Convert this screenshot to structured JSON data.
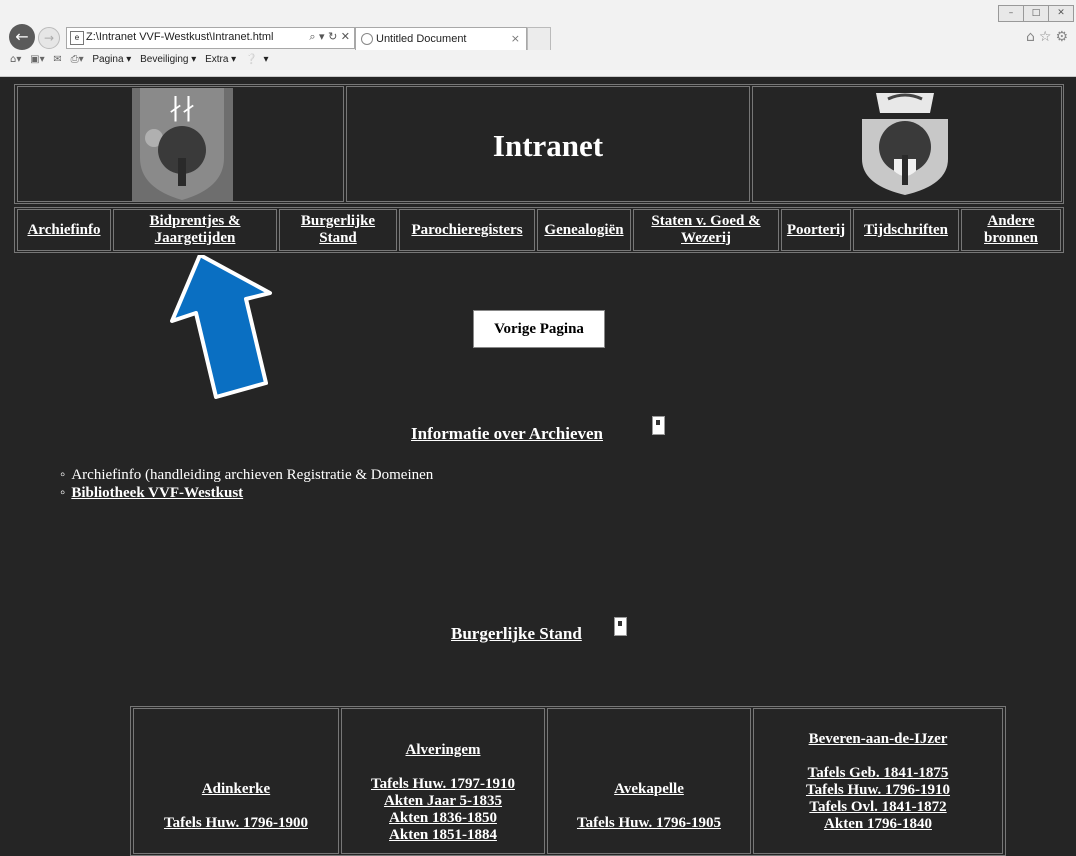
{
  "browser": {
    "address": "Z:\\Intranet VVF-Westkust\\Intranet.html",
    "address_controls": "⌕ ▾ ↻ ✕",
    "tab_title": "Untitled Document",
    "commandbar": {
      "page": "Pagina ▾",
      "security": "Beveiliging ▾",
      "extra": "Extra ▾",
      "help": "▾"
    }
  },
  "header": {
    "title": "Intranet"
  },
  "nav": [
    "Archiefinfo",
    "Bidprentjes & Jaargetijden",
    "Burgerlijke Stand",
    "Parochieregisters",
    "Genealogiën",
    "Staten v. Goed & Wezerij",
    "Poorterij",
    "Tijdschriften",
    "Andere bronnen"
  ],
  "prev_button": "Vorige Pagina",
  "section_archives": {
    "title": "Informatie over Archieven",
    "items": [
      "Archiefinfo (handleiding archieven Registratie & Domeinen",
      "Bibliotheek VVF-Westkust"
    ]
  },
  "section_stand": {
    "title": "Burgerlijke Stand"
  },
  "stand_table": [
    {
      "place": "Adinkerke",
      "links": [
        "Tafels Huw. 1796-1900"
      ]
    },
    {
      "place": "Alveringem",
      "links": [
        "Tafels Huw. 1797-1910",
        "Akten Jaar 5-1835",
        "Akten 1836-1850",
        "Akten 1851-1884"
      ]
    },
    {
      "place": "Avekapelle",
      "links": [
        "Tafels Huw. 1796-1905"
      ]
    },
    {
      "place": "Beveren-aan-de-IJzer",
      "links": [
        "Tafels Geb. 1841-1875",
        "Tafels Huw. 1796-1910",
        "Tafels Ovl. 1841-1872",
        "Akten 1796-1840"
      ]
    }
  ],
  "colors": {
    "page_bg": "#252525",
    "arrow": "#0a6fc2"
  }
}
